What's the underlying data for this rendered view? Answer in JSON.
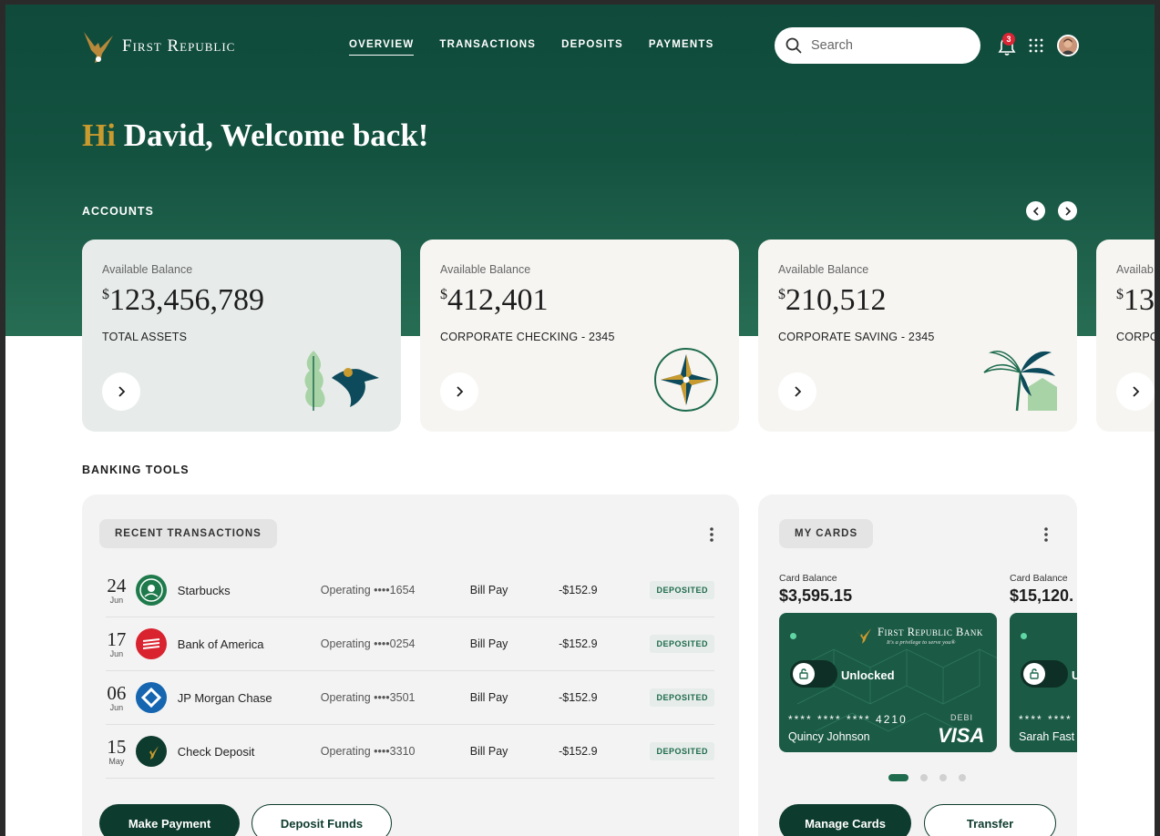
{
  "brand": {
    "name": "First Republic"
  },
  "nav": [
    "OVERVIEW",
    "TRANSACTIONS",
    "DEPOSITS",
    "PAYMENTS"
  ],
  "search": {
    "placeholder": "Search"
  },
  "notifications": {
    "count": "3"
  },
  "greeting": {
    "hi": "Hi",
    "text": "David, Welcome back!"
  },
  "accounts": {
    "title": "ACCOUNTS",
    "items": [
      {
        "label": "Available Balance",
        "currency": "$",
        "amount": "123,456,789",
        "name": "TOTAL ASSETS"
      },
      {
        "label": "Available Balance",
        "currency": "$",
        "amount": "412,401",
        "name": "CORPORATE CHECKING - 2345"
      },
      {
        "label": "Available Balance",
        "currency": "$",
        "amount": "210,512",
        "name": "CORPORATE SAVING - 2345"
      },
      {
        "label": "Availab",
        "currency": "$",
        "amount": "13",
        "name": "CORPO"
      }
    ]
  },
  "banking_tools": {
    "title": "BANKING TOOLS"
  },
  "recent_transactions": {
    "title": "RECENT TRANSACTIONS",
    "rows": [
      {
        "day": "24",
        "month": "Jun",
        "merchant": "Starbucks",
        "account": "Operating ••••1654",
        "type": "Bill Pay",
        "amount": "-$152.9",
        "status": "DEPOSITED",
        "logo_color": "#1e7a4b"
      },
      {
        "day": "17",
        "month": "Jun",
        "merchant": "Bank of America",
        "account": "Operating ••••0254",
        "type": "Bill Pay",
        "amount": "-$152.9",
        "status": "DEPOSITED",
        "logo_color": "#d9232f"
      },
      {
        "day": "06",
        "month": "Jun",
        "merchant": "JP Morgan Chase",
        "account": "Operating ••••3501",
        "type": "Bill Pay",
        "amount": "-$152.9",
        "status": "DEPOSITED",
        "logo_color": "#1565b1"
      },
      {
        "day": "15",
        "month": "May",
        "merchant": "Check Deposit",
        "account": "Operating ••••3310",
        "type": "Bill Pay",
        "amount": "-$152.9",
        "status": "DEPOSITED",
        "logo_color": "#0d3b2d"
      }
    ],
    "make_payment": "Make Payment",
    "deposit_funds": "Deposit Funds"
  },
  "my_cards": {
    "title": "MY CARDS",
    "cards": [
      {
        "balance_label": "Card Balance",
        "balance": "$3,595.15",
        "bank": "First Republic Bank",
        "tagline": "It's a privilege to serve you®",
        "state": "Unlocked",
        "number": "**** **** **** 4210",
        "holder": "Quincy Johnson",
        "type": "DEBI",
        "network": "VISA"
      },
      {
        "balance_label": "Card Balance",
        "balance": "$15,120.",
        "state": "U",
        "number": "**** ****",
        "holder": "Sarah Fast"
      }
    ],
    "manage_cards": "Manage Cards",
    "transfer": "Transfer"
  },
  "colors": {
    "brand_green": "#0f4a3b",
    "accent_gold": "#c99a2e",
    "deposit_green": "#1e6b4e",
    "badge_red": "#d92534"
  }
}
